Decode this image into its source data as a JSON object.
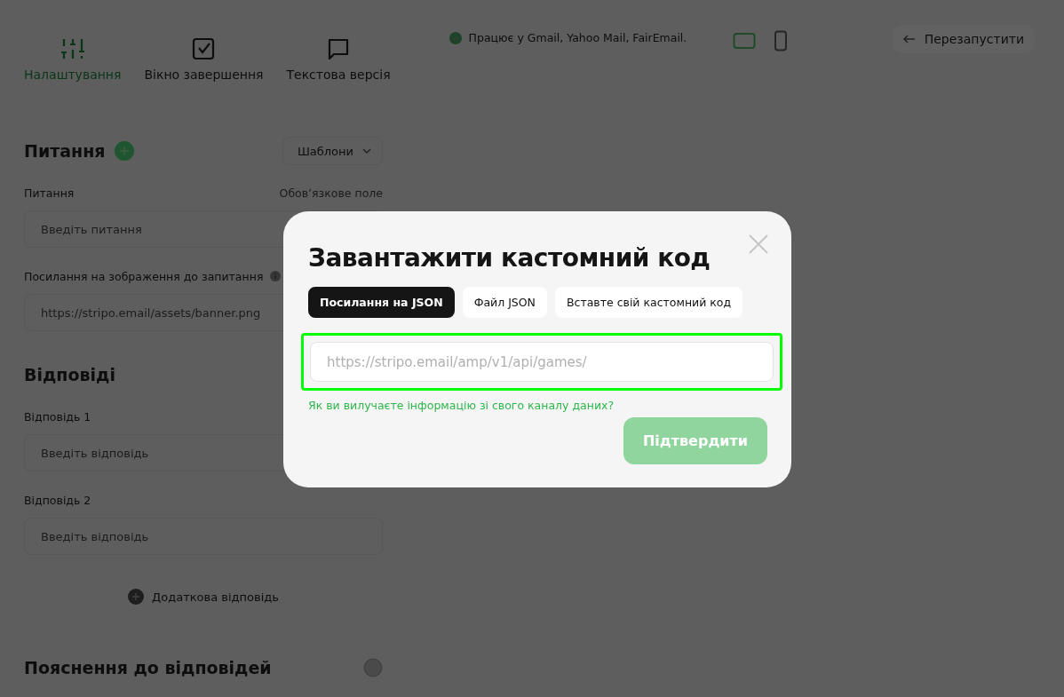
{
  "nav_tabs": [
    {
      "kind": "sliders",
      "label": "Налаштування",
      "selected": true
    },
    {
      "kind": "checkbox",
      "label": "Вікно завершення",
      "selected": false
    },
    {
      "kind": "chat",
      "label": "Текстова версія",
      "selected": false
    }
  ],
  "compatibility": {
    "text": "Працює у Gmail, Yahoo Mail, FairEmail."
  },
  "preview_modes": [
    {
      "kind": "desktop",
      "selected": true
    },
    {
      "kind": "mobile",
      "selected": false
    }
  ],
  "restart_button": {
    "label": "Перезапустити"
  },
  "question_section": {
    "title": "Питання",
    "templates_dropdown": "Шаблони",
    "fields": [
      {
        "label": "Питання",
        "hint": "Обов’язкове поле",
        "info": false,
        "placeholder": "Введіть питання"
      },
      {
        "label": "Посилання на зображення до запитання",
        "info": true,
        "placeholder": "https://stripo.email/assets/banner.png"
      }
    ]
  },
  "answers_section": {
    "title": "Відповіді",
    "fields": [
      {
        "label": "Відповідь 1",
        "info": false,
        "placeholder": "Введіть відповідь"
      },
      {
        "label": "Відповідь 2",
        "info": false,
        "placeholder": "Введіть відповідь"
      }
    ],
    "add_button": "Додаткова відповідь"
  },
  "explanations_section": {
    "title": "Пояснення до відповідей",
    "toggle": {
      "on": false
    }
  },
  "modal": {
    "title": "Завантажити кастомний код",
    "tabs": [
      {
        "label": "Посилання на JSON",
        "selected": true
      },
      {
        "label": "Файл JSON",
        "selected": false
      },
      {
        "label": "Вставте свій кастомний код",
        "selected": false
      }
    ],
    "url_field": {
      "placeholder": "https://stripo.email/amp/v1/api/games/",
      "highlighted": true
    },
    "help_link": "Як ви вилучаєте інформацію зі свого каналу даних?",
    "confirm_button": {
      "label": "Підтвердити",
      "disabled": true
    }
  }
}
